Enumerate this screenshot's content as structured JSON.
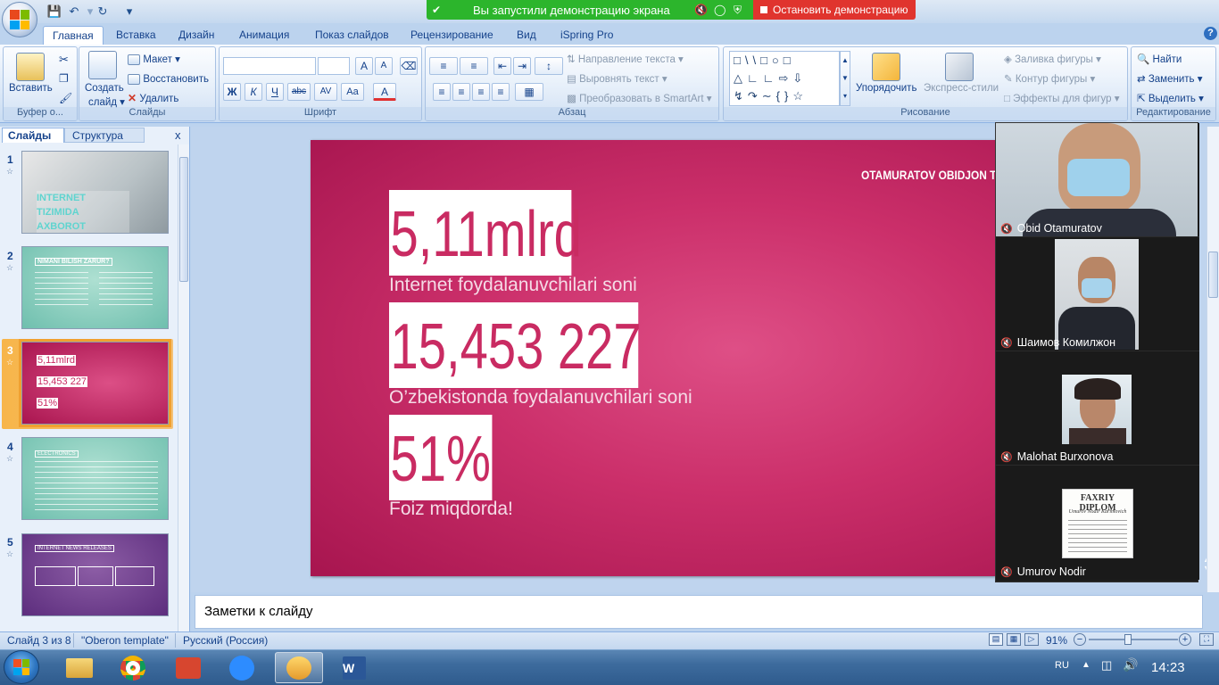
{
  "app": {
    "quick_access": {
      "save": "save-icon",
      "undo": "undo-icon",
      "redo": "redo-icon",
      "customize": "▾"
    },
    "share_banner": {
      "text": "Вы запустили демонстрацию экрана",
      "stop_label": "Остановить демонстрацию"
    },
    "help": "?"
  },
  "tabs": [
    {
      "label": "Главная"
    },
    {
      "label": "Вставка"
    },
    {
      "label": "Дизайн"
    },
    {
      "label": "Анимация"
    },
    {
      "label": "Показ слайдов"
    },
    {
      "label": "Рецензирование"
    },
    {
      "label": "Вид"
    },
    {
      "label": "iSpring Pro"
    }
  ],
  "ribbon": {
    "clipboard": {
      "group": "Буфер о...",
      "paste": "Вставить"
    },
    "slides": {
      "group": "Слайды",
      "new_slide": "Создать",
      "new_slide2": "слайд ▾",
      "layout": "Макет ▾",
      "reset": "Восстановить",
      "delete": "Удалить"
    },
    "font": {
      "group": "Шрифт",
      "bold": "Ж",
      "italic": "К",
      "underline": "Ч",
      "strike": "abc",
      "spacing": "AV",
      "case": "Aa",
      "color": "A"
    },
    "paragraph": {
      "group": "Абзац",
      "text_direction": "Направление текста ▾",
      "align_text": "Выровнять текст ▾",
      "smartart": "Преобразовать в SmartArt ▾"
    },
    "drawing": {
      "group": "Рисование",
      "arrange": "Упорядочить",
      "quick_styles": "Экспресс-стили",
      "fill": "Заливка фигуры ▾",
      "outline": "Контур фигуры ▾",
      "effects": "Эффекты для фигур ▾"
    },
    "editing": {
      "group": "Редактирование",
      "find": "Найти",
      "replace": "Заменить ▾",
      "select": "Выделить ▾"
    }
  },
  "pane": {
    "tab_slides": "Слайды",
    "tab_outline": "Структура",
    "close": "x",
    "thumbnails": [
      {
        "num": "1",
        "title": "INTERNET TIZIMIDA AXBOROT XAFVSIZLIGI"
      },
      {
        "num": "2",
        "title": "NIMANI BILISH ZARUR?"
      },
      {
        "num": "3",
        "l1": "5,11mlrd",
        "l2": "15,453 227",
        "l3": "51%"
      },
      {
        "num": "4",
        "title": "ELECTRONICS"
      },
      {
        "num": "5",
        "title": "INTERNET NEWS RELEASES"
      }
    ]
  },
  "slide": {
    "author": "OTAMURATOV OBIDJON T",
    "stat1": {
      "value": "5,11mlrd",
      "caption": "Internet foydalanuvchilari soni"
    },
    "stat2": {
      "value": "15,453 227",
      "caption": "O’zbekistonda foydalanuvchilari soni"
    },
    "stat3": {
      "value": "51%",
      "caption": "Foiz miqdorda!"
    }
  },
  "participants": [
    {
      "name": "Obid Otamuratov"
    },
    {
      "name": "Шаимов Комилжон"
    },
    {
      "name": "Malohat Burxonova"
    },
    {
      "name": "Umurov Nodir",
      "doc_title": "FAXRIY DIPLOM",
      "doc_sub": "Umurov Nodir Karimovich"
    }
  ],
  "notes": {
    "placeholder": "Заметки к слайду"
  },
  "status": {
    "slide": "Слайд 3 из 8",
    "theme": "\"Oberon template\"",
    "language": "Русский (Россия)",
    "zoom": "91%",
    "minus": "−",
    "plus": "+"
  },
  "taskbar": {
    "lang": "RU",
    "clock": "14:23"
  },
  "colors": {
    "share_green": "#2cb52c",
    "stop_red": "#e0342e",
    "slide_pink": "#cb2f6a",
    "number_pink": "#c92b62"
  }
}
